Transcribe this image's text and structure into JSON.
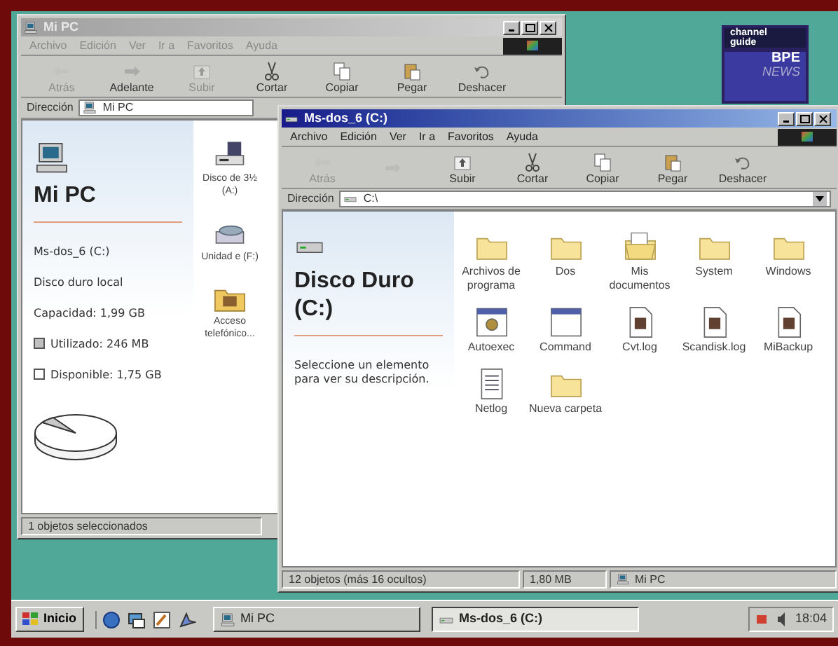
{
  "desktop": {
    "logo": {
      "line_1": "channel",
      "line_2": "guide",
      "line_3": "BPE",
      "line_4": "NEWS"
    }
  },
  "windows": [
    {
      "title": "Mi PC",
      "active": false,
      "menu": [
        "Archivo",
        "Edición",
        "Ver",
        "Ir a",
        "Favoritos",
        "Ayuda"
      ],
      "toolbar": [
        {
          "kind": "back",
          "label": "Atrás",
          "disabled": true
        },
        {
          "kind": "forward",
          "label": "Adelante",
          "disabled": false
        },
        {
          "kind": "up",
          "label": "Subir",
          "disabled": true
        },
        {
          "kind": "cut",
          "label": "Cortar",
          "disabled": false
        },
        {
          "kind": "copy",
          "label": "Copiar",
          "disabled": false
        },
        {
          "kind": "paste",
          "label": "Pegar",
          "disabled": false
        },
        {
          "kind": "undo",
          "label": "Deshacer",
          "disabled": false
        }
      ],
      "address": {
        "label": "Dirección",
        "value": "Mi PC",
        "kind": "computer"
      },
      "panel": {
        "kind": "computer",
        "title": "Mi PC",
        "lines": [
          "Ms-dos_6 (C:)",
          "Disco duro local",
          "Capacidad: 1,99 GB"
        ],
        "legend": [
          {
            "label": "Utilizado: 246 MB",
            "color": "#c0c0c0"
          },
          {
            "label": "Disponible: 1,75 GB",
            "color": "#ffffff"
          }
        ]
      },
      "items": [
        {
          "kind": "floppy",
          "label": "Disco de 3½ (A:)"
        },
        {
          "kind": "cdrom",
          "label": "Unidad e (F:)"
        },
        {
          "kind": "dialup",
          "label": "Acceso telefónico..."
        }
      ],
      "status": [
        "1 objetos seleccionados"
      ]
    },
    {
      "title": "Ms-dos_6 (C:)",
      "active": true,
      "menu": [
        "Archivo",
        "Edición",
        "Ver",
        "Ir a",
        "Favoritos",
        "Ayuda"
      ],
      "toolbar": [
        {
          "kind": "back",
          "label": "Atrás",
          "disabled": true
        },
        {
          "kind": "forward",
          "disabled": true
        },
        {
          "kind": "up",
          "label": "Subir",
          "disabled": false
        },
        {
          "kind": "cut",
          "label": "Cortar",
          "disabled": false
        },
        {
          "kind": "copy",
          "label": "Copiar",
          "disabled": false
        },
        {
          "kind": "paste",
          "label": "Pegar",
          "disabled": false
        },
        {
          "kind": "undo",
          "label": "Deshacer",
          "disabled": false
        }
      ],
      "address": {
        "label": "Dirección",
        "value": "C:\\",
        "kind": "drive"
      },
      "panel": {
        "kind": "drive",
        "title": "Disco Duro (C:)",
        "lines": [
          "Seleccione un elemento para ver su descripción."
        ]
      },
      "items": [
        {
          "kind": "folder",
          "label": "Archivos de programa"
        },
        {
          "kind": "folder",
          "label": "Dos"
        },
        {
          "kind": "documents",
          "label": "Mis documentos"
        },
        {
          "kind": "folder",
          "label": "System"
        },
        {
          "kind": "folder",
          "label": "Windows"
        },
        {
          "kind": "settings",
          "label": "Autoexec"
        },
        {
          "kind": "program",
          "label": "Command"
        },
        {
          "kind": "log",
          "label": "Cvt.log"
        },
        {
          "kind": "log",
          "label": "Scandisk.log"
        },
        {
          "kind": "log",
          "label": "MiBackup"
        },
        {
          "kind": "text",
          "label": "Netlog"
        },
        {
          "kind": "folder",
          "label": "Nueva carpeta"
        }
      ],
      "status": [
        "12 objetos (más 16 ocultos)",
        "1,80 MB",
        "Mi PC"
      ]
    }
  ],
  "taskbar": {
    "start": "Inicio",
    "tasks": [
      {
        "label": "Mi PC",
        "kind": "computer",
        "selected": false
      },
      {
        "label": "Ms-dos_6 (C:)",
        "kind": "drive",
        "selected": true
      }
    ],
    "clock": "18:04"
  }
}
